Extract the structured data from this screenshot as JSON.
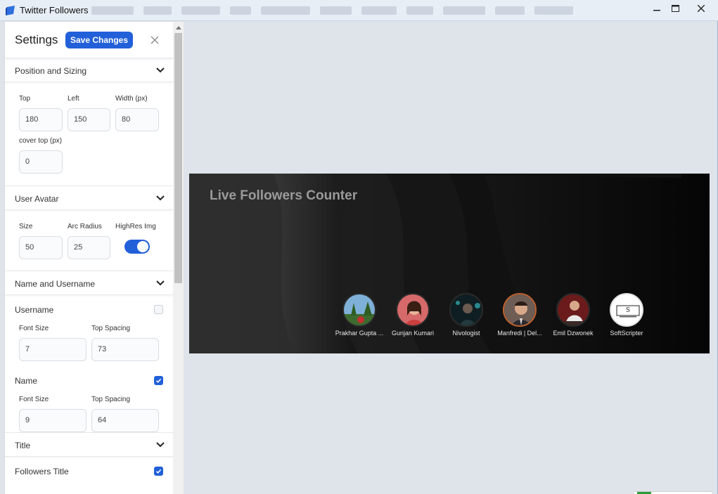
{
  "window": {
    "title": "Twitter Followers"
  },
  "sidebar": {
    "title": "Settings",
    "save_label": "Save Changes",
    "sections": {
      "position": {
        "label": "Position and Sizing",
        "fields": {
          "top": {
            "label": "Top",
            "value": "180"
          },
          "left": {
            "label": "Left",
            "value": "150"
          },
          "width": {
            "label": "Width (px)",
            "value": "80"
          },
          "cover_top": {
            "label": "cover top (px)",
            "value": "0"
          }
        }
      },
      "avatar": {
        "label": "User Avatar",
        "fields": {
          "size": {
            "label": "Size",
            "value": "50"
          },
          "arc_radius": {
            "label": "Arc Radius",
            "value": "25"
          },
          "highres": {
            "label": "HighRes Img",
            "on": true
          }
        }
      },
      "name_username": {
        "label": "Name and Username",
        "username": {
          "label": "Username",
          "checked": false,
          "font_size": {
            "label": "Font Size",
            "value": "7"
          },
          "top_spacing": {
            "label": "Top Spacing",
            "value": "73"
          }
        },
        "name": {
          "label": "Name",
          "checked": true,
          "font_size": {
            "label": "Font Size",
            "value": "9"
          },
          "top_spacing": {
            "label": "Top Spacing",
            "value": "64"
          }
        }
      },
      "title": {
        "label": "Title",
        "followers_title": {
          "label": "Followers Title",
          "checked": true
        }
      }
    }
  },
  "preview": {
    "title": "Live Followers Counter",
    "followers": [
      {
        "name": "Prakhar Gupta ..."
      },
      {
        "name": "Gunjan Kumari"
      },
      {
        "name": "Nivologist"
      },
      {
        "name": "Manfredi | Del..."
      },
      {
        "name": "Emil Dzwonek"
      },
      {
        "name": "SoftScripter"
      }
    ]
  },
  "colors": {
    "accent": "#2260d9",
    "banner_bg": "#0b0b0b",
    "canvas_bg": "#dfe3ea"
  }
}
